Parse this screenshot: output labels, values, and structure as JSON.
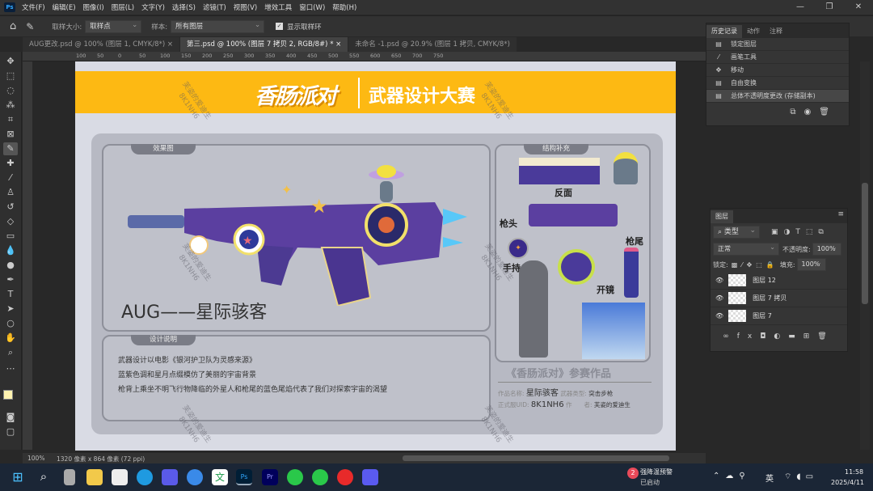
{
  "menu": {
    "app_icon": "Ps",
    "items": [
      "文件(F)",
      "编辑(E)",
      "图像(I)",
      "图层(L)",
      "文字(Y)",
      "选择(S)",
      "滤镜(T)",
      "视图(V)",
      "增效工具",
      "窗口(W)",
      "帮助(H)"
    ]
  },
  "options": {
    "sample_size_label": "取样大小:",
    "sample_size_value": "取样点",
    "sample_label": "样本:",
    "sample_value": "所有图层",
    "show_ring_label": "显示取样环",
    "show_ring_checked": true
  },
  "tabs": [
    {
      "label": "AUG更改.psd @ 100% (图层 1, CMYK/8*)",
      "active": false
    },
    {
      "label": "第三.psd @ 100% (图层 7 拷贝 2, RGB/8#) *",
      "active": true
    },
    {
      "label": "未命名 -1.psd @ 20.9% (图层 1 拷贝, CMYK/8*)",
      "active": false
    }
  ],
  "ruler": [
    "100",
    "50",
    "0",
    "50",
    "100",
    "150",
    "200",
    "250",
    "300",
    "350",
    "400",
    "450",
    "500",
    "550",
    "600",
    "650",
    "700",
    "750"
  ],
  "document": {
    "banner_logo": "香肠派对",
    "banner_title": "武器设计大赛",
    "effect_label": "效果图",
    "weapon_title": "AUG——星际骇客",
    "notes_label": "设计说明",
    "notes": [
      "武器设计以电影《银河护卫队为灵感来源》",
      "蓝紫色调和星月点缀模仿了美丽的宇宙背景",
      "枪背上乘坐不明飞行物降临的外星人和枪尾的蓝色尾焰代表了我们对探索宇宙的渴望"
    ],
    "structure_label": "结构补充",
    "structure_notes": {
      "reverse": "反面",
      "muzzle": "枪头",
      "grip": "手持",
      "stock": "枪尾",
      "scope": "开镜"
    },
    "entry_title": "《香肠派对》参赛作品",
    "entry": {
      "name_label": "作品名称:",
      "name": "星际骇客",
      "type_label": "武器类型:",
      "type": "突击步枪",
      "uid_label": "正式服UID:",
      "uid": "8K1NH6",
      "author_label": "作　　者:",
      "author": "芙姿的爱迪生"
    },
    "watermark_name": "芙姿的爱迪生",
    "watermark_uid": "8K1NH6"
  },
  "status": {
    "zoom": "100%",
    "size": "1320 像素 x 864 像素 (72 ppi)"
  },
  "history": {
    "tabs": [
      "历史记录",
      "动作",
      "注释"
    ],
    "items": [
      "锁定图层",
      "画笔工具",
      "移动",
      "自由变换",
      "总体不透明度更改 (存储副本)"
    ]
  },
  "layers": {
    "tab": "图层",
    "filter": "类型",
    "blend": "正常",
    "opacity_label": "不透明度:",
    "opacity": "100%",
    "lock_label": "锁定:",
    "fill_label": "填充:",
    "fill": "100%",
    "items": [
      "图层 12",
      "图层 7 拷贝",
      "图层 7"
    ]
  },
  "taskbar": {
    "weather_badge": "2",
    "weather_title": "强降温预警",
    "weather_sub": "已启动",
    "ime": "英",
    "time": "11:58",
    "date": "2025/4/11"
  },
  "colors": {
    "banner": "#fdb913",
    "ps_blue": "#31a8ff"
  }
}
